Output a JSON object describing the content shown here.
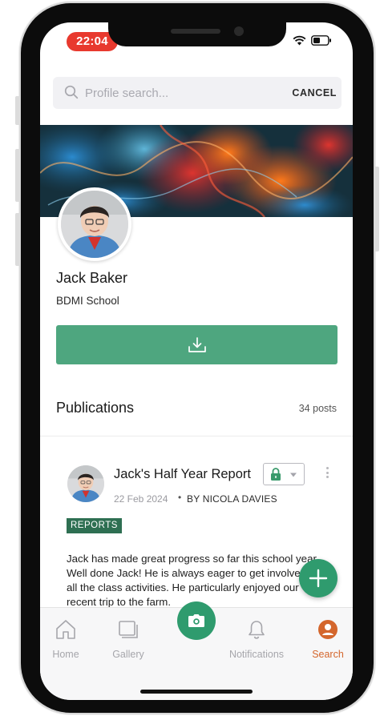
{
  "status_bar": {
    "time": "22:04"
  },
  "search": {
    "placeholder": "Profile search...",
    "cancel_label": "CANCEL"
  },
  "profile": {
    "name": "Jack Baker",
    "school": "BDMI School"
  },
  "publications": {
    "heading": "Publications",
    "count": "34 posts"
  },
  "post": {
    "title": "Jack's Half Year Report",
    "date": "22 Feb 2024",
    "separator": "•",
    "author": "BY NICOLA DAVIES",
    "tag": "REPORTS",
    "body": "Jack has made great progress so far this school year. Well done Jack! He is always eager to get involved in all the class activities. He particularly enjoyed our recent trip to the farm."
  },
  "nav": {
    "home": "Home",
    "gallery": "Gallery",
    "notifications": "Notifications",
    "search": "Search"
  },
  "colors": {
    "accent_green": "#4ea67f",
    "fab_green": "#2f9b6e",
    "tag_green": "#2e6f52",
    "active_nav": "#d4662c",
    "time_pill": "#e8392e"
  },
  "icons": {
    "search": "search-icon",
    "download": "download-icon",
    "lock": "lock-icon",
    "add": "plus-icon",
    "camera": "camera-icon",
    "home": "home-icon",
    "gallery": "gallery-icon",
    "notifications": "bell-icon",
    "profile": "user-icon"
  }
}
